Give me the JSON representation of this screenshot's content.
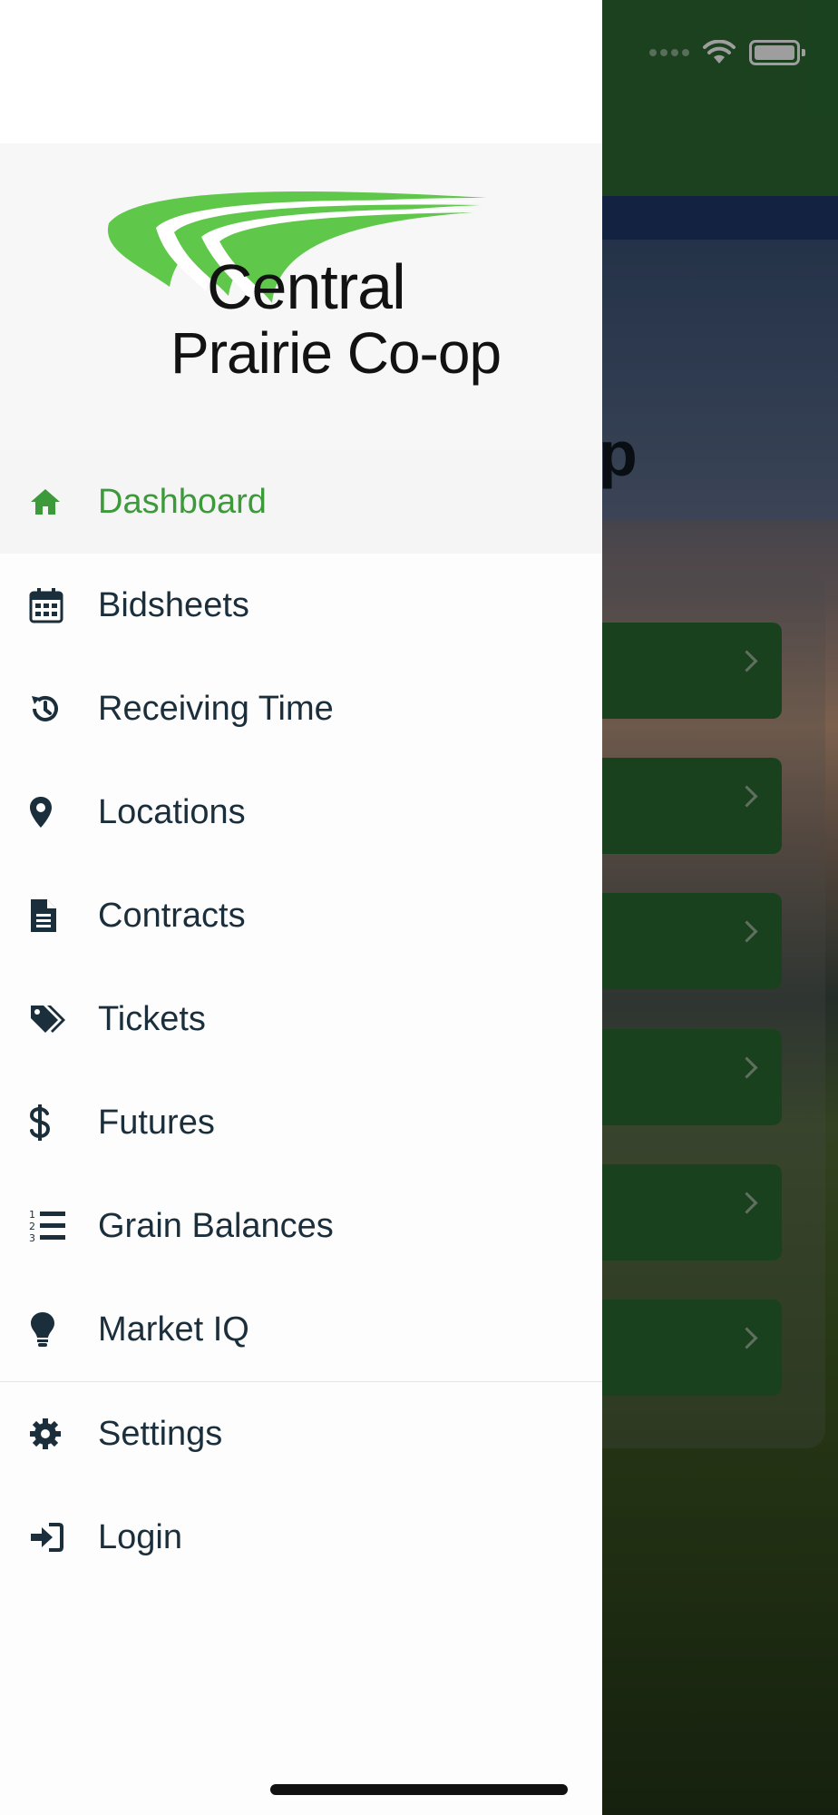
{
  "brand": {
    "line1": "Central",
    "line2": "Prairie Co-op",
    "accent_color": "#3d9a3a",
    "swoosh_color": "#5fc74a"
  },
  "menu": {
    "items": [
      {
        "label": "Dashboard",
        "icon": "home-icon",
        "active": true
      },
      {
        "label": "Bidsheets",
        "icon": "calendar-icon"
      },
      {
        "label": "Receiving Time",
        "icon": "history-icon"
      },
      {
        "label": "Locations",
        "icon": "map-marker-icon"
      },
      {
        "label": "Contracts",
        "icon": "document-icon"
      },
      {
        "label": "Tickets",
        "icon": "tags-icon"
      },
      {
        "label": "Futures",
        "icon": "dollar-icon"
      },
      {
        "label": "Grain Balances",
        "icon": "numbered-list-icon"
      },
      {
        "label": "Market IQ",
        "icon": "lightbulb-icon"
      }
    ],
    "footer_items": [
      {
        "label": "Settings",
        "icon": "gear-icon"
      },
      {
        "label": "Login",
        "icon": "sign-in-icon"
      }
    ]
  },
  "background_app": {
    "header_color": "#2c6a31",
    "row_color": "#2b6a30",
    "title_fragment": "p"
  }
}
